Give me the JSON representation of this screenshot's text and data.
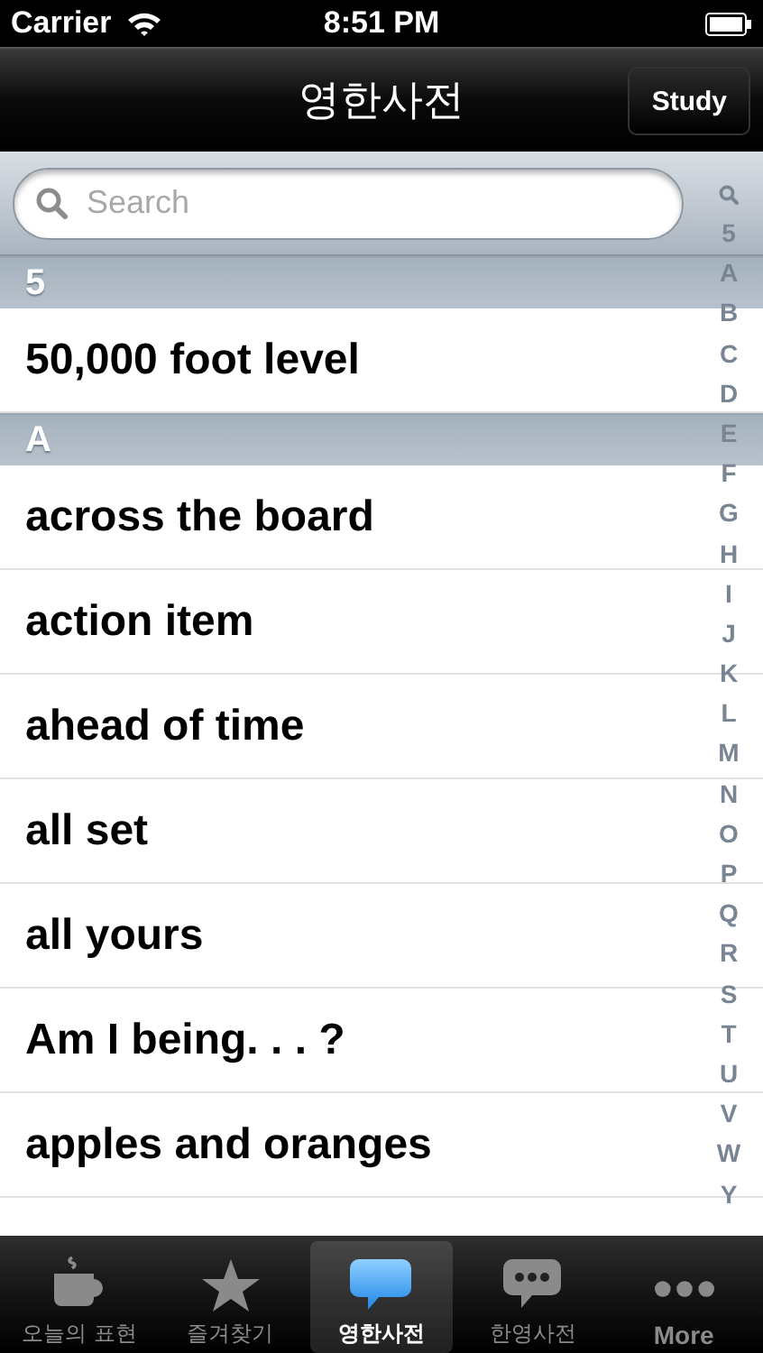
{
  "status_bar": {
    "carrier": "Carrier",
    "time": "8:51 PM"
  },
  "nav_bar": {
    "title": "영한사전",
    "button": "Study"
  },
  "search": {
    "placeholder": "Search"
  },
  "sections": [
    {
      "header": "5",
      "rows": [
        "50,000 foot level"
      ]
    },
    {
      "header": "A",
      "rows": [
        "across the board",
        "action item",
        "ahead of time",
        "all set",
        "all yours",
        "Am I being. . . ?",
        "apples and oranges"
      ]
    }
  ],
  "index": [
    "5",
    "A",
    "B",
    "C",
    "D",
    "E",
    "F",
    "G",
    "H",
    "I",
    "J",
    "K",
    "L",
    "M",
    "N",
    "O",
    "P",
    "Q",
    "R",
    "S",
    "T",
    "U",
    "V",
    "W",
    "Y"
  ],
  "tab_bar": [
    {
      "kind": "cup",
      "label": "오늘의 표현",
      "selected": false
    },
    {
      "kind": "star",
      "label": "즐겨찾기",
      "selected": false
    },
    {
      "kind": "bubble",
      "label": "영한사전",
      "selected": true
    },
    {
      "kind": "dots-bubble",
      "label": "한영사전",
      "selected": false
    },
    {
      "kind": "more",
      "label": "More",
      "selected": false
    }
  ]
}
